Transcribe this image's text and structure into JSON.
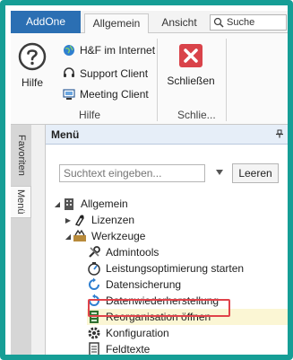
{
  "ribbon": {
    "tabs": [
      {
        "label": "AddOne",
        "active": false
      },
      {
        "label": "Allgemein",
        "active": true
      },
      {
        "label": "Ansicht",
        "active": false
      }
    ],
    "search_label": "Suche",
    "groups": {
      "hilfe": {
        "label": "Hilfe",
        "big_button": "Hilfe",
        "items": [
          "H&F im Internet",
          "Support Client",
          "Meeting Client"
        ]
      },
      "schliessen": {
        "label": "Schlie...",
        "big_button": "Schließen"
      }
    }
  },
  "sidebar": {
    "tabs": [
      "Favoriten",
      "Menü"
    ]
  },
  "menu_panel": {
    "title": "Menü",
    "search_placeholder": "Suchtext eingeben...",
    "clear_button": "Leeren",
    "tree": [
      {
        "label": "Allgemein",
        "level": 0,
        "expanded": true,
        "icon": "building-icon"
      },
      {
        "label": "Lizenzen",
        "level": 1,
        "expanded": false,
        "icon": "license-icon"
      },
      {
        "label": "Werkzeuge",
        "level": 1,
        "expanded": true,
        "icon": "tools-icon"
      },
      {
        "label": "Admintools",
        "level": 2,
        "icon": "wrench-icon"
      },
      {
        "label": "Leistungsoptimierung starten",
        "level": 2,
        "icon": "performance-icon"
      },
      {
        "label": "Datensicherung",
        "level": 2,
        "icon": "backup-icon"
      },
      {
        "label": "Datenwiederherstellung",
        "level": 2,
        "icon": "restore-icon"
      },
      {
        "label": "Reorganisation öffnen",
        "level": 2,
        "icon": "reorganize-icon",
        "selected": true
      },
      {
        "label": "Konfiguration",
        "level": 2,
        "icon": "gear-icon"
      },
      {
        "label": "Feldtexte",
        "level": 2,
        "icon": "document-icon"
      }
    ]
  },
  "colors": {
    "frame": "#169e96",
    "addone_tab": "#2b6fb3",
    "highlight": "#e0434a",
    "selection": "#fbf6d4",
    "close_icon": "#d9434a"
  }
}
